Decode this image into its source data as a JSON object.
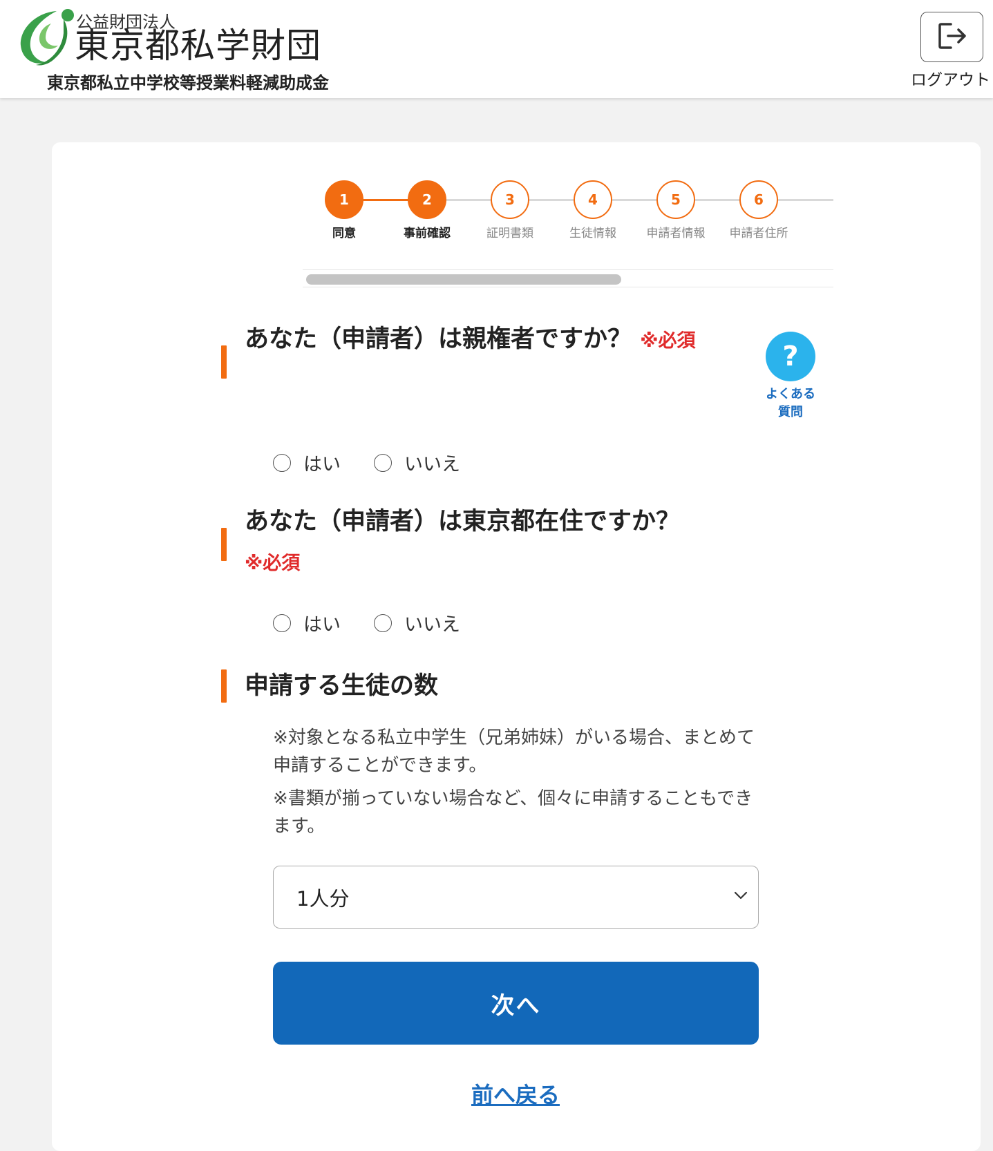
{
  "header": {
    "org_type": "公益財団法人",
    "org_name": "東京都私学財団",
    "program_name": "東京都私立中学校等授業料軽減助成金",
    "logout_label": "ログアウト"
  },
  "stepper": {
    "steps": [
      {
        "number": "1",
        "label": "同意",
        "state": "done"
      },
      {
        "number": "2",
        "label": "事前確認",
        "state": "current"
      },
      {
        "number": "3",
        "label": "証明書類",
        "state": "pending"
      },
      {
        "number": "4",
        "label": "生徒情報",
        "state": "pending"
      },
      {
        "number": "5",
        "label": "申請者情報",
        "state": "pending"
      },
      {
        "number": "6",
        "label": "申請者住所",
        "state": "pending"
      }
    ]
  },
  "faq": {
    "icon": "?",
    "label_line1": "よくある",
    "label_line2": "質問"
  },
  "questions": {
    "q1": {
      "text": "あなた（申請者）は親権者ですか？",
      "required": "※必須",
      "yes": "はい",
      "no": "いいえ"
    },
    "q2": {
      "text": "あなた（申請者）は東京都在住ですか？",
      "required": "※必須",
      "yes": "はい",
      "no": "いいえ"
    },
    "q3": {
      "text": "申請する生徒の数"
    }
  },
  "notes": [
    "※対象となる私立中学生（兄弟姉妹）がいる場合、まとめて申請することができます。",
    "※書類が揃っていない場合など、個々に申請することもできます。"
  ],
  "student_count": {
    "selected": "1人分"
  },
  "buttons": {
    "next": "次へ",
    "back": "前へ戻る"
  },
  "colors": {
    "accent_orange": "#f26c11",
    "primary_blue": "#1268b9",
    "required_red": "#e02b2b",
    "faq_blue": "#2bb3ec"
  }
}
